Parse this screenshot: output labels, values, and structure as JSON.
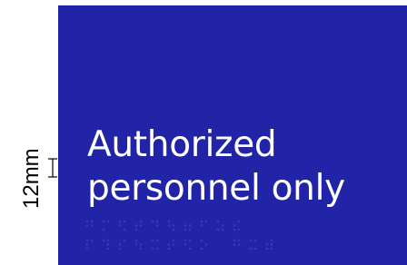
{
  "colors": {
    "sign_background": "#2124a7",
    "sign_text": "#ffffff",
    "dimension_ink": "#000000",
    "braille_dots": "#3538b6"
  },
  "dimension": {
    "label": "12mm"
  },
  "sign": {
    "line1": "Authorized",
    "line2": "personnel only"
  },
  "braille": {
    "rows": [
      [
        [
          1,
          1,
          0,
          1,
          1,
          0
        ],
        [
          1,
          0,
          1,
          1,
          0,
          0
        ],
        [
          1,
          1,
          0,
          1,
          0,
          1
        ],
        [
          0,
          1,
          1,
          1,
          1,
          0
        ],
        [
          1,
          0,
          0,
          1,
          1,
          0
        ],
        [
          1,
          1,
          0,
          0,
          1,
          1
        ],
        [
          0,
          1,
          1,
          0,
          1,
          1
        ],
        [
          1,
          1,
          0,
          1,
          0,
          0
        ],
        [
          1,
          0,
          1,
          0,
          1,
          1
        ],
        [
          0,
          1,
          1,
          1,
          0,
          1
        ]
      ],
      [
        [
          1,
          1,
          1,
          1,
          0,
          0
        ],
        [
          1,
          0,
          0,
          1,
          1,
          1
        ],
        [
          0,
          1,
          1,
          1,
          0,
          0
        ],
        [
          1,
          1,
          0,
          0,
          1,
          1
        ],
        [
          1,
          0,
          1,
          1,
          0,
          1
        ],
        [
          0,
          1,
          1,
          1,
          1,
          0
        ],
        [
          1,
          1,
          0,
          1,
          0,
          1
        ],
        [
          1,
          0,
          1,
          0,
          1,
          0
        ],
        [
          0,
          0,
          0,
          0,
          0,
          0
        ],
        [
          1,
          1,
          0,
          1,
          1,
          0
        ],
        [
          1,
          0,
          1,
          1,
          0,
          1
        ],
        [
          0,
          1,
          1,
          1,
          1,
          1
        ]
      ]
    ]
  }
}
